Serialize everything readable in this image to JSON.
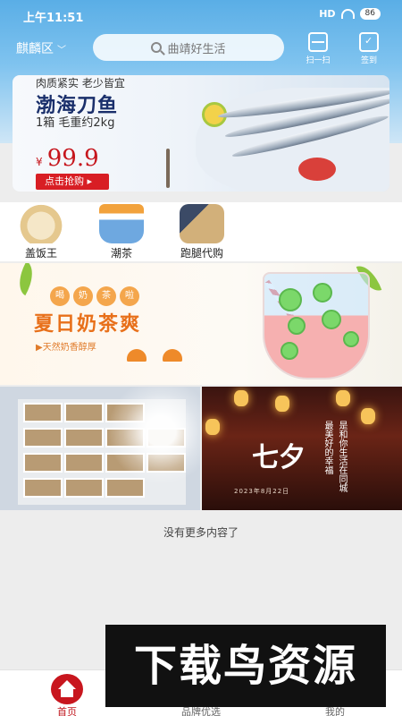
{
  "status_bar": {
    "time": "上午11:51",
    "signal": "HD",
    "battery": "86"
  },
  "header": {
    "city": "麒麟区",
    "search_placeholder": "曲靖好生活",
    "scan_label": "扫一扫",
    "sign_label": "签到"
  },
  "banner": {
    "tagline": "肉质紧实 老少皆宜",
    "product_name": "渤海刀鱼",
    "spec": "1箱 毛重约2kg",
    "currency": "¥",
    "price": "99.9",
    "buy_label": "点击抢购"
  },
  "categories": [
    {
      "label": "盖饭王"
    },
    {
      "label": "潮茶"
    },
    {
      "label": "跑腿代购"
    }
  ],
  "promo_milktea": {
    "bubbles": [
      "喝",
      "奶",
      "茶",
      "啦"
    ],
    "title": "夏日奶茶爽",
    "subtitle": "▶天然奶香醇厚"
  },
  "promo_qixi": {
    "title": "七夕",
    "date": "2023年8月22日",
    "vertical_line1": "最美好的幸福",
    "vertical_line2": "是和你生活在同城"
  },
  "feed_end_text": "没有更多内容了",
  "watermark_text": "下载鸟资源",
  "tabbar": {
    "home": "首页",
    "brand": "品牌优选",
    "mine": "我的"
  },
  "colors": {
    "accent_red": "#c8161e",
    "header_blue": "#5aaee6",
    "promo_orange": "#e8701a"
  }
}
